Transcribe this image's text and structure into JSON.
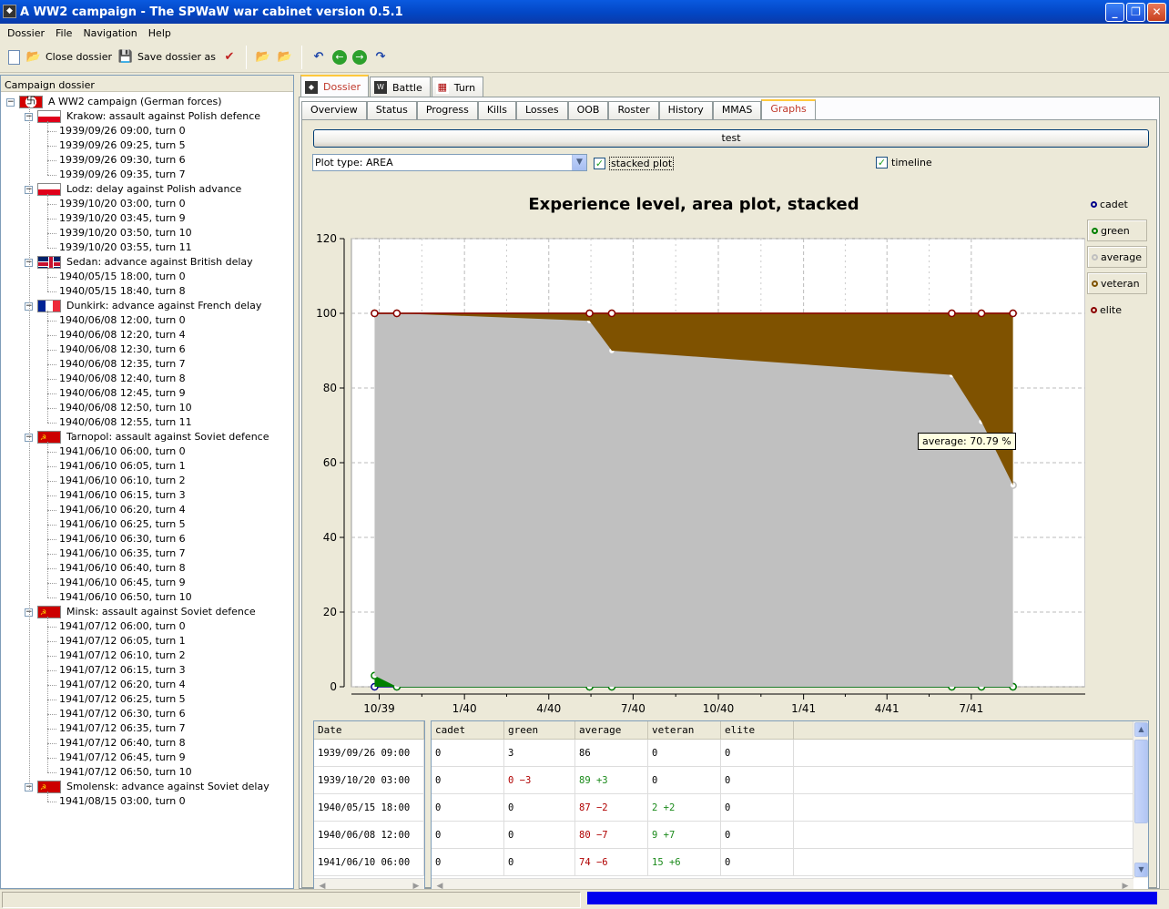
{
  "window": {
    "title": "A WW2 campaign - The SPWaW war cabinet version 0.5.1",
    "icon": "app-icon"
  },
  "menu": [
    "Dossier",
    "File",
    "Navigation",
    "Help"
  ],
  "toolbar": {
    "close_label": "Close dossier",
    "save_as_label": "Save dossier as"
  },
  "left_panel": {
    "title": "Campaign dossier"
  },
  "tree": [
    {
      "label": "A WW2 campaign (German forces)",
      "flag": "de",
      "children": []
    },
    {
      "label": "Krakow: assault against Polish defence",
      "flag": "pl",
      "children": [
        "1939/09/26 09:00, turn 0",
        "1939/09/26 09:25, turn 5",
        "1939/09/26 09:30, turn 6",
        "1939/09/26 09:35, turn 7"
      ]
    },
    {
      "label": "Lodz: delay against Polish advance",
      "flag": "pl",
      "children": [
        "1939/10/20 03:00, turn 0",
        "1939/10/20 03:45, turn 9",
        "1939/10/20 03:50, turn 10",
        "1939/10/20 03:55, turn 11"
      ]
    },
    {
      "label": "Sedan: advance against British delay",
      "flag": "uk",
      "children": [
        "1940/05/15 18:00, turn 0",
        "1940/05/15 18:40, turn 8"
      ]
    },
    {
      "label": "Dunkirk: advance against French delay",
      "flag": "fr",
      "children": [
        "1940/06/08 12:00, turn 0",
        "1940/06/08 12:20, turn 4",
        "1940/06/08 12:30, turn 6",
        "1940/06/08 12:35, turn 7",
        "1940/06/08 12:40, turn 8",
        "1940/06/08 12:45, turn 9",
        "1940/06/08 12:50, turn 10",
        "1940/06/08 12:55, turn 11"
      ]
    },
    {
      "label": "Tarnopol: assault against Soviet defence",
      "flag": "su",
      "children": [
        "1941/06/10 06:00, turn 0",
        "1941/06/10 06:05, turn 1",
        "1941/06/10 06:10, turn 2",
        "1941/06/10 06:15, turn 3",
        "1941/06/10 06:20, turn 4",
        "1941/06/10 06:25, turn 5",
        "1941/06/10 06:30, turn 6",
        "1941/06/10 06:35, turn 7",
        "1941/06/10 06:40, turn 8",
        "1941/06/10 06:45, turn 9",
        "1941/06/10 06:50, turn 10"
      ]
    },
    {
      "label": "Minsk: assault against Soviet defence",
      "flag": "su",
      "children": [
        "1941/07/12 06:00, turn 0",
        "1941/07/12 06:05, turn 1",
        "1941/07/12 06:10, turn 2",
        "1941/07/12 06:15, turn 3",
        "1941/07/12 06:20, turn 4",
        "1941/07/12 06:25, turn 5",
        "1941/07/12 06:30, turn 6",
        "1941/07/12 06:35, turn 7",
        "1941/07/12 06:40, turn 8",
        "1941/07/12 06:45, turn 9",
        "1941/07/12 06:50, turn 10"
      ]
    },
    {
      "label": "Smolensk: advance against Soviet delay",
      "flag": "su",
      "children": [
        "1941/08/15 03:00, turn 0"
      ]
    }
  ],
  "main_tabs": [
    {
      "label": "Dossier",
      "active": true
    },
    {
      "label": "Battle",
      "active": false
    },
    {
      "label": "Turn",
      "active": false
    }
  ],
  "sub_tabs": [
    {
      "label": "Overview"
    },
    {
      "label": "Status"
    },
    {
      "label": "Progress"
    },
    {
      "label": "Kills"
    },
    {
      "label": "Losses"
    },
    {
      "label": "OOB"
    },
    {
      "label": "Roster"
    },
    {
      "label": "History"
    },
    {
      "label": "MMAS"
    },
    {
      "label": "Graphs",
      "active": true
    }
  ],
  "graphs": {
    "test_button": "test",
    "plot_type": "Plot type: AREA",
    "stacked_label": "stacked plot",
    "stacked_checked": true,
    "timeline_label": "timeline",
    "timeline_checked": true,
    "tooltip": "average: 70.79 %"
  },
  "chart_data": {
    "type": "area",
    "title": "Experience level, area plot, stacked",
    "stacked": true,
    "x_ticks": [
      "10/39",
      "1/40",
      "4/40",
      "7/40",
      "10/40",
      "1/41",
      "4/41",
      "7/41"
    ],
    "ylim": [
      0,
      120
    ],
    "y_ticks": [
      0,
      20,
      40,
      60,
      80,
      100,
      120
    ],
    "grid": true,
    "legend_position": "right",
    "x": [
      "1939/09/26",
      "1939/10/20",
      "1940/05/15",
      "1940/06/08",
      "1941/06/10",
      "1941/07/12",
      "1941/08/15"
    ],
    "series": [
      {
        "name": "cadet",
        "color": "#00008b",
        "values": [
          0,
          0,
          0,
          0,
          0,
          0,
          0
        ]
      },
      {
        "name": "green",
        "color": "#008000",
        "values": [
          3,
          0,
          0,
          0,
          0,
          0,
          0
        ]
      },
      {
        "name": "average",
        "color": "#c0c0c0",
        "values": [
          97,
          100,
          98,
          90,
          83.5,
          71,
          54
        ]
      },
      {
        "name": "veteran",
        "color": "#7f5200",
        "values": [
          0,
          0,
          2,
          10,
          16.5,
          29,
          46
        ]
      },
      {
        "name": "elite",
        "color": "#8b0000",
        "values": [
          0,
          0,
          0,
          0,
          0,
          0,
          0
        ]
      }
    ]
  },
  "table": {
    "date_header": "Date",
    "columns": [
      "cadet",
      "green",
      "average",
      "veteran",
      "elite"
    ],
    "rows": [
      {
        "date": "1939/09/26 09:00",
        "cells": [
          {
            "v": "0"
          },
          {
            "v": "3"
          },
          {
            "v": "86"
          },
          {
            "v": "0"
          },
          {
            "v": "0"
          }
        ]
      },
      {
        "date": "1939/10/20 03:00",
        "cells": [
          {
            "v": "0"
          },
          {
            "v": "0 −3",
            "c": "red"
          },
          {
            "v": "89 +3",
            "c": "grn"
          },
          {
            "v": "0"
          },
          {
            "v": "0"
          }
        ]
      },
      {
        "date": "1940/05/15 18:00",
        "cells": [
          {
            "v": "0"
          },
          {
            "v": "0"
          },
          {
            "v": "87 −2",
            "c": "red"
          },
          {
            "v": "2 +2",
            "c": "grn"
          },
          {
            "v": "0"
          }
        ]
      },
      {
        "date": "1940/06/08 12:00",
        "cells": [
          {
            "v": "0"
          },
          {
            "v": "0"
          },
          {
            "v": "80 −7",
            "c": "red"
          },
          {
            "v": "9 +7",
            "c": "grn"
          },
          {
            "v": "0"
          }
        ]
      },
      {
        "date": "1941/06/10 06:00",
        "cells": [
          {
            "v": "0"
          },
          {
            "v": "0"
          },
          {
            "v": "74 −6",
            "c": "red"
          },
          {
            "v": "15 +6",
            "c": "grn"
          },
          {
            "v": "0"
          }
        ]
      }
    ]
  }
}
